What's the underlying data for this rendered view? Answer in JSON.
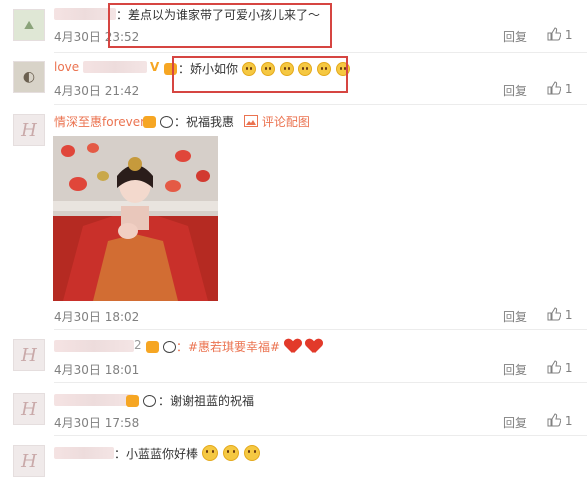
{
  "comments": [
    {
      "name": "",
      "text": "：差点以为谁家带了可爱小孩儿来了～",
      "time": "4月30日 23:52",
      "reply": "回复",
      "likes": "1"
    },
    {
      "name": "love",
      "text": "：娇小如你",
      "time": "4月30日 21:42",
      "reply": "回复",
      "likes": "1"
    },
    {
      "name": "情深至惠forever",
      "text": "：祝福我惠",
      "report": "评论配图",
      "time": "4月30日 18:02",
      "reply": "回复",
      "likes": "1"
    },
    {
      "name": "2",
      "text": "：#惠若琪要幸福#",
      "time": "4月30日 18:01",
      "reply": "回复",
      "likes": "1"
    },
    {
      "name": "",
      "text": "：谢谢祖蓝的祝福",
      "time": "4月30日 17:58",
      "reply": "回复",
      "likes": "1"
    },
    {
      "name": "",
      "text": "：小蓝蓝你好棒",
      "time": "",
      "reply": "",
      "likes": ""
    }
  ],
  "colors": {
    "highlight_box": "#d64541",
    "name_link": "#eb7350",
    "meta": "#808080"
  },
  "icons": {
    "like": "thumb-up-icon",
    "image_report": "picture-icon"
  }
}
